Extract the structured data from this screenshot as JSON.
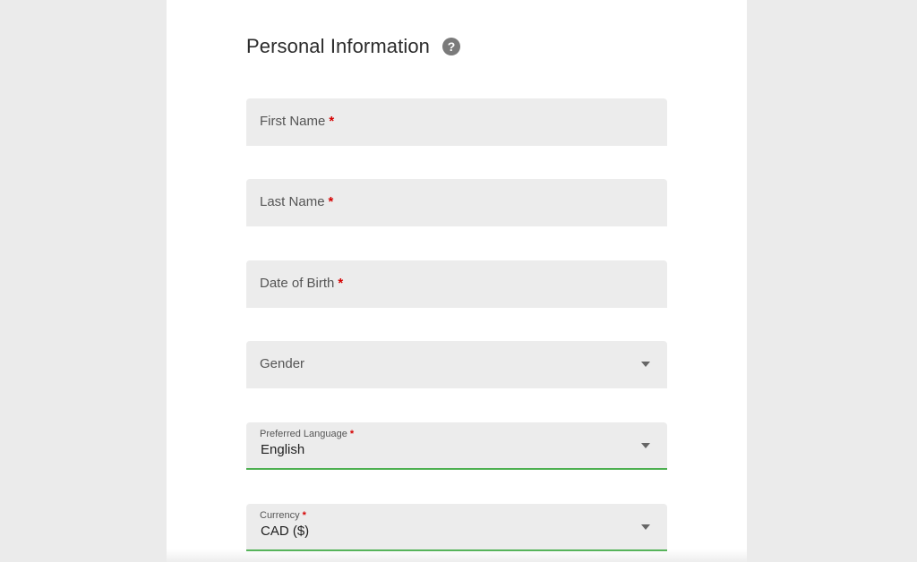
{
  "section": {
    "title": "Personal Information",
    "help_icon": "question-mark-icon",
    "help_glyph": "?"
  },
  "fields": {
    "first_name": {
      "label": "First Name",
      "required_mark": "*"
    },
    "last_name": {
      "label": "Last Name",
      "required_mark": "*"
    },
    "date_of_birth": {
      "label": "Date of Birth",
      "required_mark": "*"
    },
    "gender": {
      "label": "Gender",
      "icon": "chevron-down-icon"
    },
    "preferred_language": {
      "label": "Preferred Language",
      "required_mark": "*",
      "value": "English",
      "icon": "chevron-down-icon"
    },
    "currency": {
      "label": "Currency",
      "required_mark": "*",
      "value": "CAD ($)",
      "icon": "chevron-down-icon"
    }
  },
  "colors": {
    "page_background": "#ebebeb",
    "panel_background": "#ffffff",
    "field_background": "#ececec",
    "required_mark": "#d50000",
    "active_underline": "#4caf50"
  }
}
